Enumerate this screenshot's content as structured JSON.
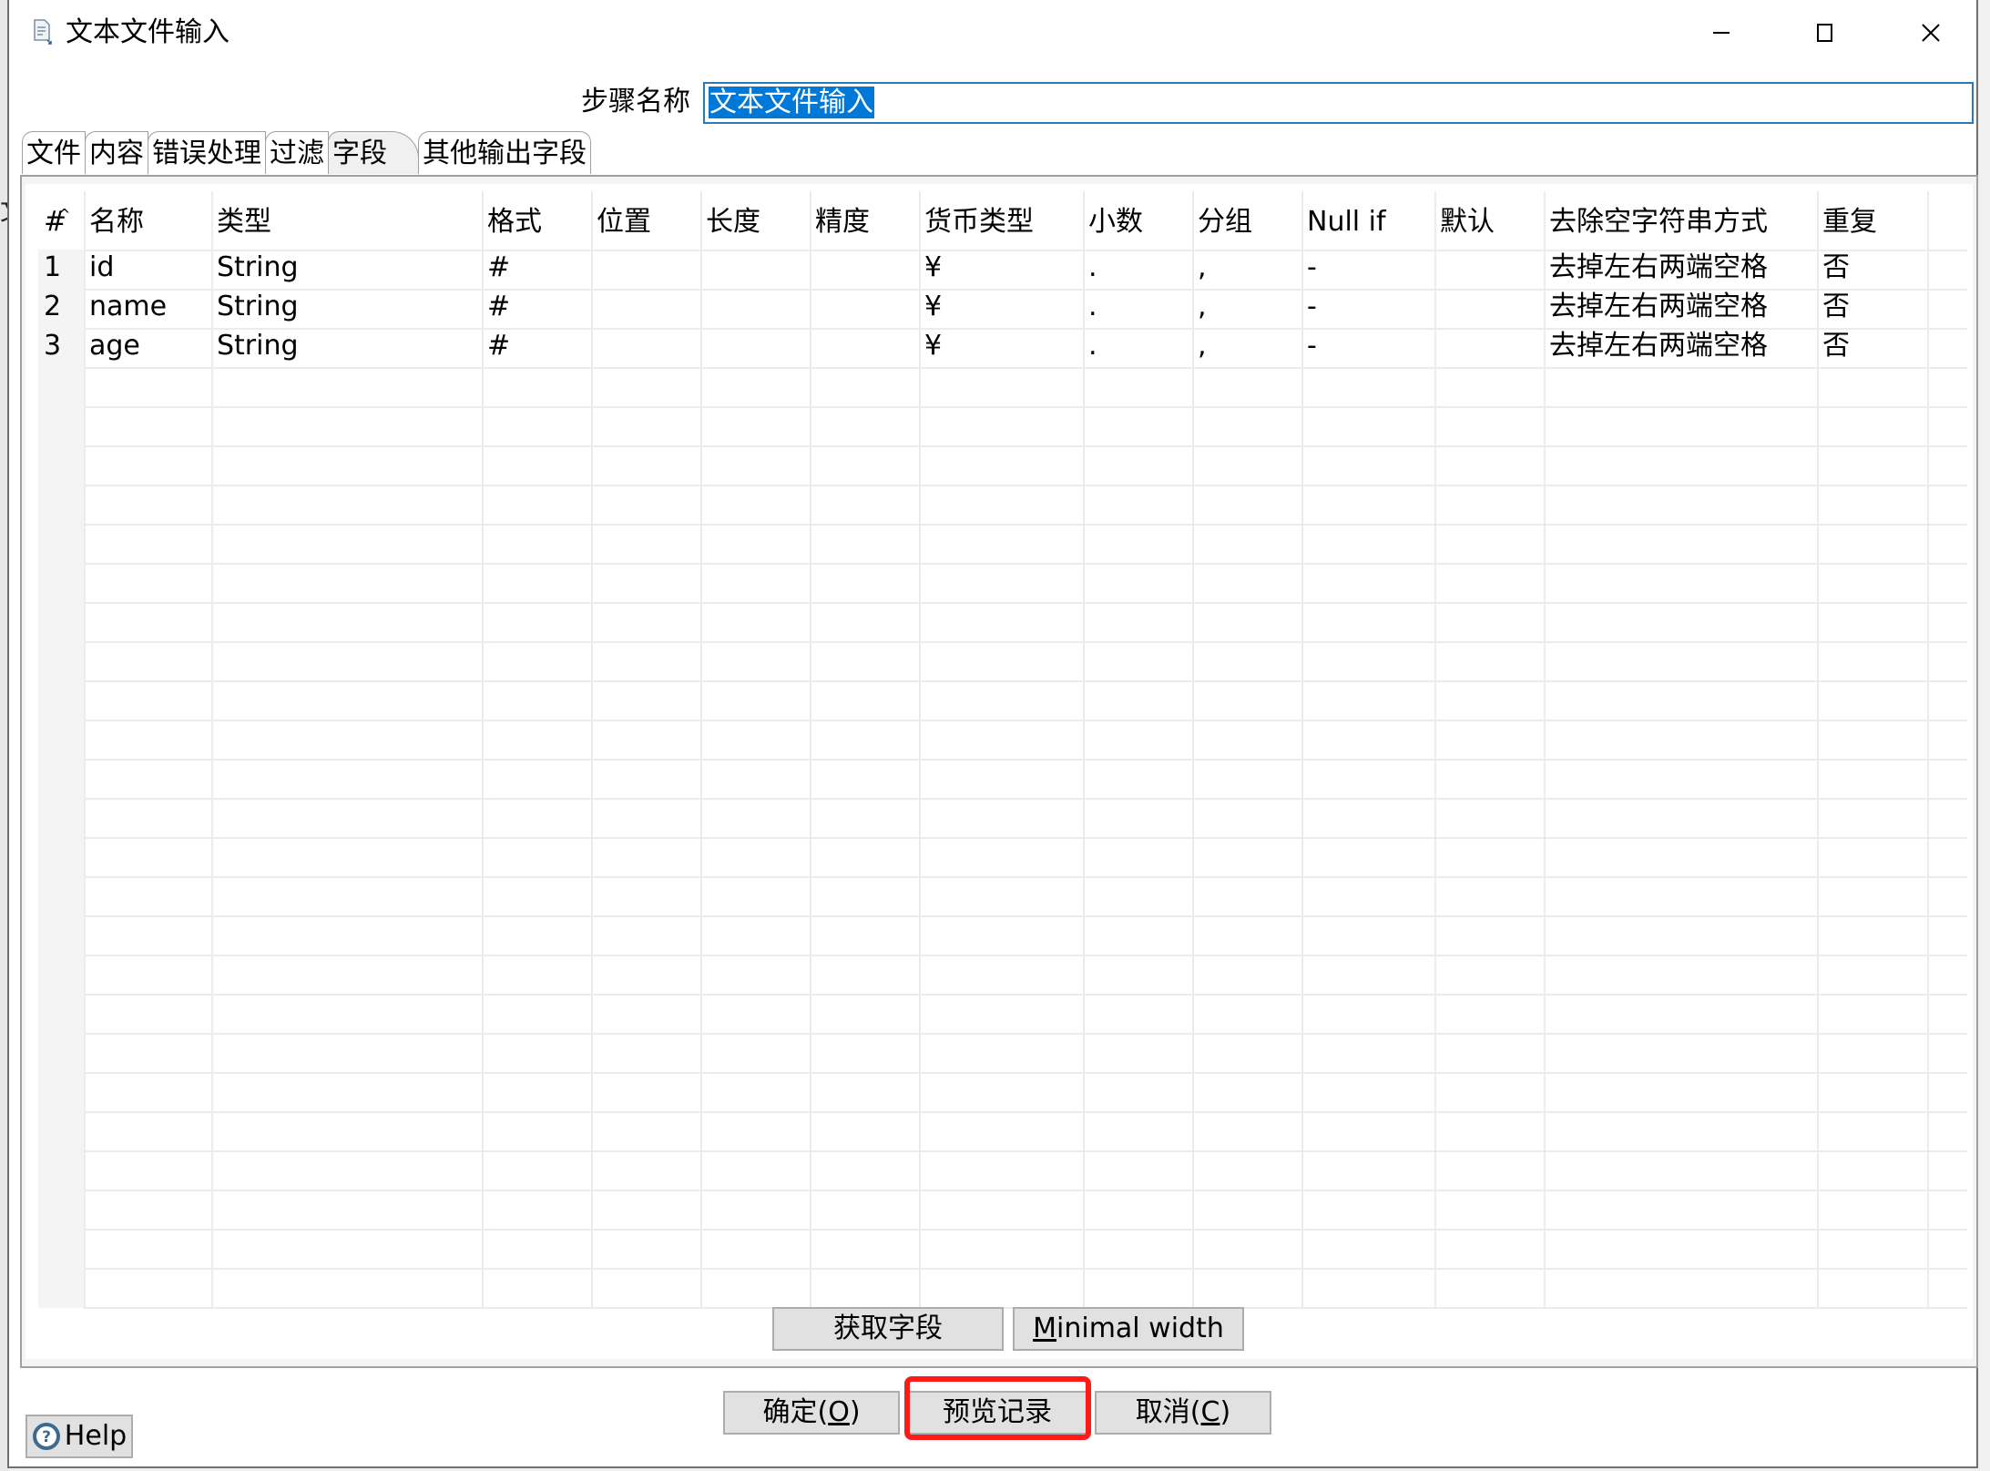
{
  "window": {
    "title": "文本文件输入",
    "icon": "document-input-icon",
    "controls": {
      "minimize": "minimize-icon",
      "maximize": "maximize-icon",
      "close": "close-icon"
    }
  },
  "step_name": {
    "label": "步骤名称",
    "value": "文本文件输入"
  },
  "tabs": [
    {
      "label": "文件",
      "active": false
    },
    {
      "label": "内容",
      "active": false
    },
    {
      "label": "错误处理",
      "active": false
    },
    {
      "label": "过滤",
      "active": false
    },
    {
      "label": "字段",
      "active": true
    },
    {
      "label": "其他输出字段",
      "active": false
    }
  ],
  "table": {
    "columns": [
      "#",
      "名称",
      "类型",
      "格式",
      "位置",
      "长度",
      "精度",
      "货币类型",
      "小数",
      "分组",
      "Null if",
      "默认",
      "去除空字符串方式",
      "重复"
    ],
    "rows": [
      [
        "1",
        "id",
        "String",
        "#",
        "",
        "",
        "",
        "¥",
        ".",
        ",",
        "-",
        "",
        "去掉左右两端空格",
        "否"
      ],
      [
        "2",
        "name",
        "String",
        "#",
        "",
        "",
        "",
        "¥",
        ".",
        ",",
        "-",
        "",
        "去掉左右两端空格",
        "否"
      ],
      [
        "3",
        "age",
        "String",
        "#",
        "",
        "",
        "",
        "¥",
        ".",
        ",",
        "-",
        "",
        "去掉左右两端空格",
        "否"
      ]
    ]
  },
  "panel_buttons": {
    "get_fields": "获取字段",
    "minimal_width_mnemonic": "M",
    "minimal_width_rest": "inimal width"
  },
  "dialog_buttons": {
    "ok_text": "确定(",
    "ok_mnemonic": "O",
    "ok_close": ")",
    "preview": "预览记录",
    "cancel_text": "取消(",
    "cancel_mnemonic": "C",
    "cancel_close": ")",
    "highlighted": "预览记录"
  },
  "help": {
    "label": "Help",
    "icon": "help-icon"
  },
  "colors": {
    "selection": "#0078d7",
    "input_border": "#2a7ab8",
    "highlight_box": "#ff1a1a",
    "button_bg": "#e1e1e1"
  }
}
